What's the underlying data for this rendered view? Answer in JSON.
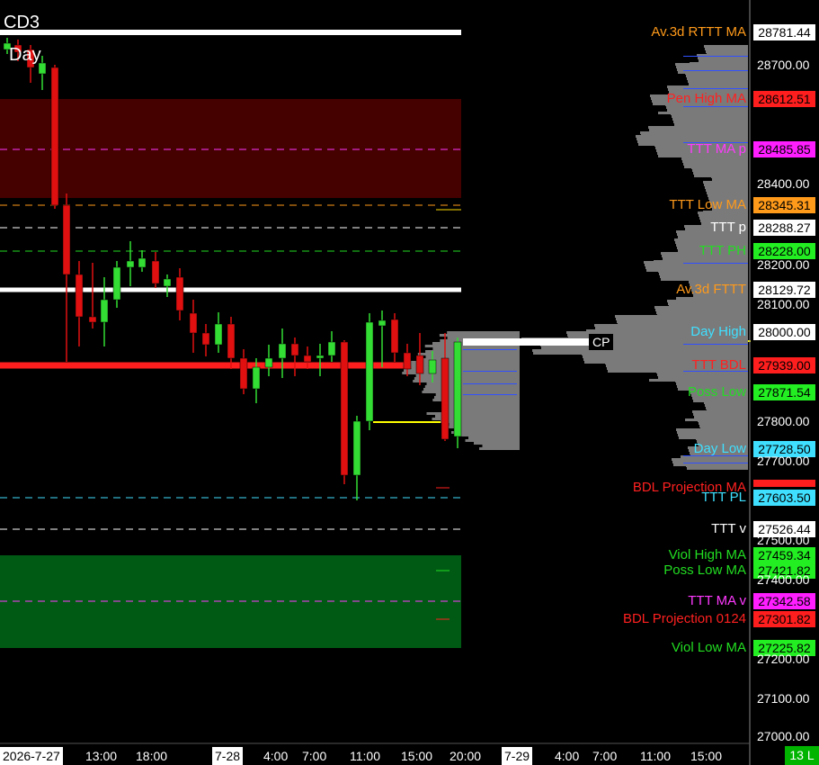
{
  "chart_labels": {
    "symbol": "CD3",
    "timeframe": "Day",
    "cp_label": "CP",
    "status_count": "13 L"
  },
  "price_axis_ticks": [
    "28700.00",
    "28400.00",
    "28200.00",
    "28100.00",
    "27800.00",
    "27700.00",
    "27500.00",
    "27400.00",
    "27200.00",
    "27100.00",
    "27000.00"
  ],
  "time_axis": {
    "date_boxes": [
      "2026-7-27",
      "7-28",
      "7-29"
    ],
    "labels": [
      "13:00",
      "18:00",
      "4:00",
      "7:00",
      "11:00",
      "15:00",
      "20:00",
      "4:00",
      "7:00",
      "11:00",
      "15:00"
    ]
  },
  "levels": [
    {
      "label": "Av.3d RTTT MA",
      "value": "28781.44",
      "label_color": "#ff9a1a",
      "tag_bg": "#ffffff",
      "tag_fg": "#000000"
    },
    {
      "label": "Pen High MA",
      "value": "28612.51",
      "label_color": "#ff2020",
      "tag_bg": "#ff1e1e",
      "tag_fg": "#000000"
    },
    {
      "label": "TTT MA p",
      "value": "28485.85",
      "label_color": "#ff39ff",
      "tag_bg": "#ff1eff",
      "tag_fg": "#000000"
    },
    {
      "label": "TTT Low MA",
      "value": "28345.31",
      "label_color": "#ff9a1a",
      "tag_bg": "#ff9a1a",
      "tag_fg": "#000000"
    },
    {
      "label": "TTT p",
      "value": "28288.27",
      "label_color": "#ffffff",
      "tag_bg": "#ffffff",
      "tag_fg": "#000000"
    },
    {
      "label": "TTT PH",
      "value": "28228.00",
      "label_color": "#22dd22",
      "tag_bg": "#22ee22",
      "tag_fg": "#000000"
    },
    {
      "label": "Av.3d FTTT",
      "value": "28129.72",
      "label_color": "#ff9a1a",
      "tag_bg": "#ffffff",
      "tag_fg": "#000000"
    },
    {
      "label": "Day High",
      "value": "28000.00",
      "label_color": "#3fe0ff",
      "tag_bg": "#ffffff",
      "tag_fg": "#000000"
    },
    {
      "label": "TTT BDL",
      "value": "27939.00",
      "label_color": "#ff2020",
      "tag_bg": "#ff1e1e",
      "tag_fg": "#000000"
    },
    {
      "label": "Poss Low",
      "value": "27871.54",
      "label_color": "#22dd22",
      "tag_bg": "#22ee22",
      "tag_fg": "#000000"
    },
    {
      "label": "Day Low",
      "value": "27728.50",
      "label_color": "#3fe0ff",
      "tag_bg": "#3fe0ff",
      "tag_fg": "#000000"
    },
    {
      "label": "BDL Projection MA",
      "value": "",
      "label_color": "#ff2020",
      "tag_bg": "#ff1e1e",
      "tag_fg": "#000000"
    },
    {
      "label": "TTT PL",
      "value": "27603.50",
      "label_color": "#3fe0ff",
      "tag_bg": "#3fe0ff",
      "tag_fg": "#000000"
    },
    {
      "label": "TTT v",
      "value": "27526.44",
      "label_color": "#ffffff",
      "tag_bg": "#ffffff",
      "tag_fg": "#000000"
    },
    {
      "label": "Viol High MA",
      "value": "27459.34",
      "label_color": "#22dd22",
      "tag_bg": "#22ee22",
      "tag_fg": "#000000"
    },
    {
      "label": "Poss Low MA",
      "value": "27421.82",
      "label_color": "#22dd22",
      "tag_bg": "#22ee22",
      "tag_fg": "#000000"
    },
    {
      "label": "TTT MA v",
      "value": "27342.58",
      "label_color": "#ff39ff",
      "tag_bg": "#ff1eff",
      "tag_fg": "#000000"
    },
    {
      "label": "BDL Projection 0124",
      "value": "27301.82",
      "label_color": "#ff2020",
      "tag_bg": "#ff1e1e",
      "tag_fg": "#000000"
    },
    {
      "label": "Viol Low MA",
      "value": "27225.82",
      "label_color": "#22dd22",
      "tag_bg": "#22ee22",
      "tag_fg": "#000000"
    }
  ]
}
